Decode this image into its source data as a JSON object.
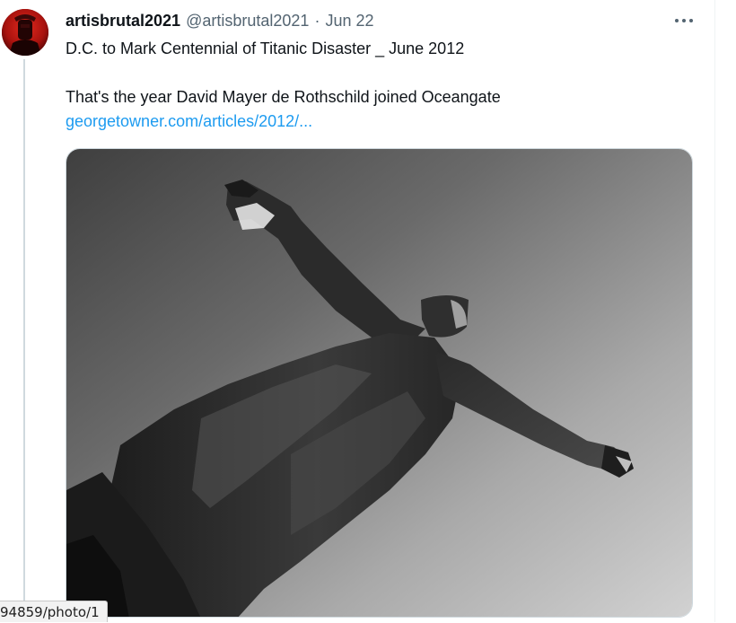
{
  "tweet": {
    "display_name": "artisbrutal2021",
    "handle": "@artisbrutal2021",
    "separator": "·",
    "timestamp": "Jun 22",
    "more_label": "···",
    "text_line_1": "D.C. to Mark Centennial of Titanic Disaster _ June 2012",
    "text_line_2": "That's the year David Mayer de Rothschild joined Oceangate",
    "link_text": "georgetowner.com/articles/2012/...",
    "media_icon": "statue-photo"
  },
  "avatar": {
    "icon": "red-figure-avatar",
    "color": "#b51515"
  },
  "status_bar": {
    "url": "94859/photo/1"
  },
  "colors": {
    "link": "#1d9bf0",
    "secondary_text": "#536471",
    "primary_text": "#0f1419",
    "thread_line": "#cfd9de"
  }
}
